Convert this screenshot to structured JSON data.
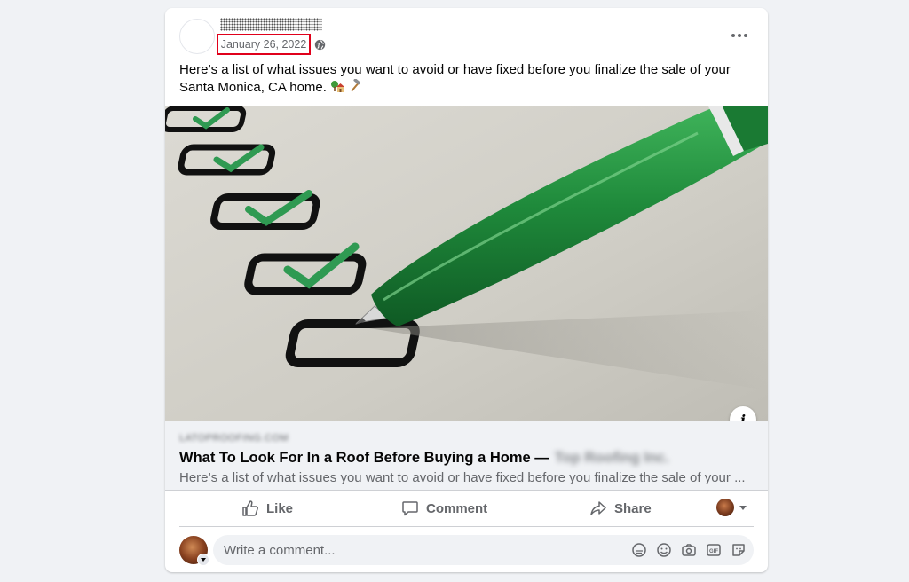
{
  "post": {
    "date": "January 26, 2022",
    "text_line1": "Here’s a list of what issues you want to avoid or have fixed before you finalize the sale of your",
    "text_line2": "Santa Monica, CA home.",
    "emojis": [
      "house-with-tree-icon",
      "hammer-icon"
    ]
  },
  "link": {
    "domain": "LATOPROOFING.COM",
    "title": "What To Look For In a Roof Before Buying a Home —",
    "site_name": "Top Roofing Inc.",
    "description": "Here’s a list of what issues you want to avoid or have fixed before you finalize the sale of your ..."
  },
  "actions": {
    "like_label": "Like",
    "comment_label": "Comment",
    "share_label": "Share"
  },
  "comment_box": {
    "placeholder": "Write a comment..."
  },
  "colors": {
    "pen_green": "#1f8a3b",
    "check_green": "#2f9a52",
    "highlight_red": "#e0001b",
    "secondary_text": "#65676b"
  }
}
